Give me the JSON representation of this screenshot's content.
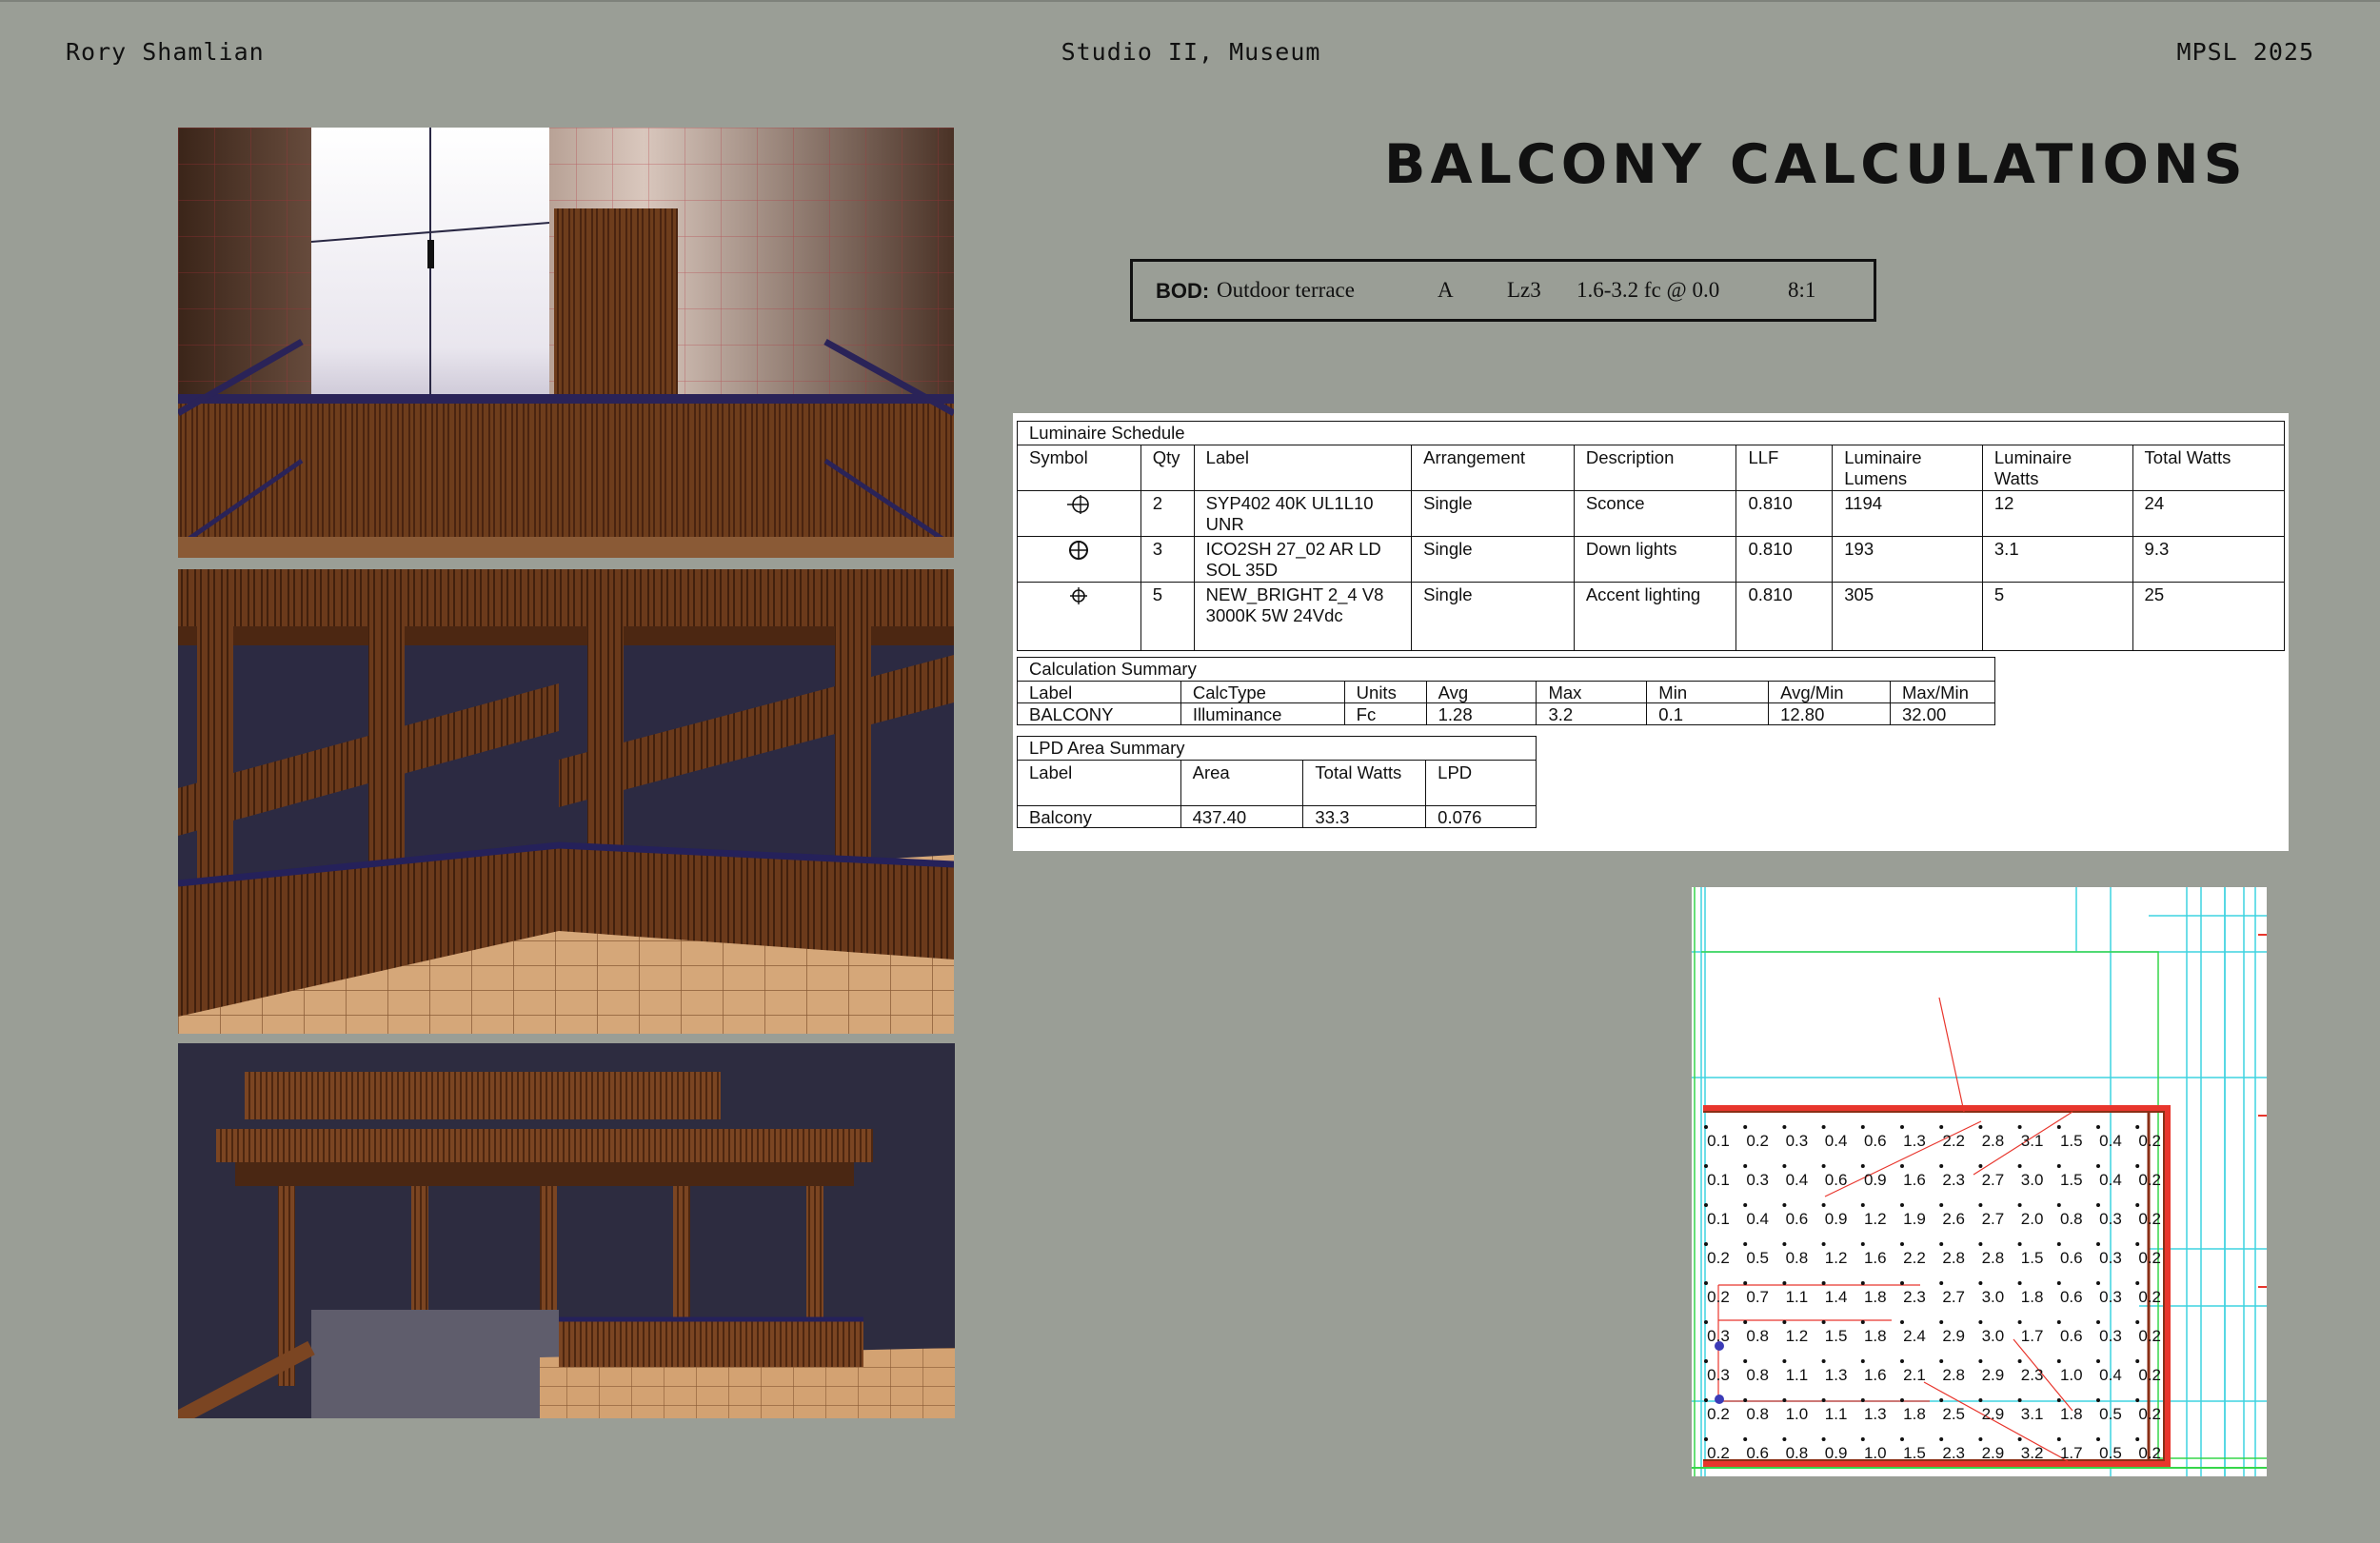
{
  "header": {
    "author": "Rory Shamlian",
    "course": "Studio II, Museum",
    "program": "MPSL 2025"
  },
  "title": "BALCONY CALCULATIONS",
  "bod": {
    "label": "BOD:",
    "space": "Outdoor terrace",
    "category": "A",
    "zone": "Lz3",
    "target": "1.6-3.2 fc @ 0.0",
    "ratio": "8:1"
  },
  "luminaire_schedule": {
    "caption": "Luminaire Schedule",
    "headers": [
      "Symbol",
      "Qty",
      "Label",
      "Arrangement",
      "Description",
      "LLF",
      "Luminaire Lumens",
      "Luminaire Watts",
      "Total Watts"
    ],
    "rows": [
      {
        "symbol": "sconce-symbol",
        "qty": "2",
        "label": "SYP402 40K UL1L10 UNR",
        "arrangement": "Single",
        "description": "Sconce",
        "llf": "0.810",
        "lumens": "1194",
        "watts": "12",
        "total_watts": "24"
      },
      {
        "symbol": "downlight-symbol",
        "qty": "3",
        "label": "ICO2SH 27_02 AR LD SOL 35D",
        "arrangement": "Single",
        "description": "Down lights",
        "llf": "0.810",
        "lumens": "193",
        "watts": "3.1",
        "total_watts": "9.3"
      },
      {
        "symbol": "accent-symbol",
        "qty": "5",
        "label": "NEW_BRIGHT 2_4 V8 3000K 5W 24Vdc",
        "arrangement": "Single",
        "description": "Accent lighting",
        "llf": "0.810",
        "lumens": "305",
        "watts": "5",
        "total_watts": "25"
      }
    ]
  },
  "calculation_summary": {
    "caption": "Calculation Summary",
    "headers": [
      "Label",
      "CalcType",
      "Units",
      "Avg",
      "Max",
      "Min",
      "Avg/Min",
      "Max/Min"
    ],
    "row": [
      "BALCONY",
      "Illuminance",
      "Fc",
      "1.28",
      "3.2",
      "0.1",
      "12.80",
      "32.00"
    ]
  },
  "lpd_summary": {
    "caption": "LPD Area Summary",
    "headers": [
      "Label",
      "Area",
      "Total Watts",
      "LPD"
    ],
    "row": [
      "Balcony",
      "437.40",
      "33.3",
      "0.076"
    ]
  },
  "illuminance_grid": [
    [
      "0.1",
      "0.2",
      "0.3",
      "0.4",
      "0.6",
      "1.3",
      "2.2",
      "2.8",
      "3.1",
      "1.5",
      "0.4",
      "0.2"
    ],
    [
      "0.1",
      "0.3",
      "0.4",
      "0.6",
      "0.9",
      "1.6",
      "2.3",
      "2.7",
      "3.0",
      "1.5",
      "0.4",
      "0.2"
    ],
    [
      "0.1",
      "0.4",
      "0.6",
      "0.9",
      "1.2",
      "1.9",
      "2.6",
      "2.7",
      "2.0",
      "0.8",
      "0.3",
      "0.2"
    ],
    [
      "0.2",
      "0.5",
      "0.8",
      "1.2",
      "1.6",
      "2.2",
      "2.8",
      "2.8",
      "1.5",
      "0.6",
      "0.3",
      "0.2"
    ],
    [
      "0.2",
      "0.7",
      "1.1",
      "1.4",
      "1.8",
      "2.3",
      "2.7",
      "3.0",
      "1.8",
      "0.6",
      "0.3",
      "0.2"
    ],
    [
      "0.3",
      "0.8",
      "1.2",
      "1.5",
      "1.8",
      "2.4",
      "2.9",
      "3.0",
      "1.7",
      "0.6",
      "0.3",
      "0.2"
    ],
    [
      "0.3",
      "0.8",
      "1.1",
      "1.3",
      "1.6",
      "2.1",
      "2.8",
      "2.9",
      "2.3",
      "1.0",
      "0.4",
      "0.2"
    ],
    [
      "0.2",
      "0.8",
      "1.0",
      "1.1",
      "1.3",
      "1.8",
      "2.5",
      "2.9",
      "3.1",
      "1.8",
      "0.5",
      "0.2"
    ],
    [
      "0.2",
      "0.6",
      "0.8",
      "0.9",
      "1.0",
      "1.5",
      "2.3",
      "2.9",
      "3.2",
      "1.7",
      "0.5",
      "0.2"
    ]
  ],
  "colors": {
    "background": "#9a9e96",
    "calc_line": "#e8362d",
    "guide_cyan": "#3fd3e0",
    "guide_green": "#36d64a"
  }
}
